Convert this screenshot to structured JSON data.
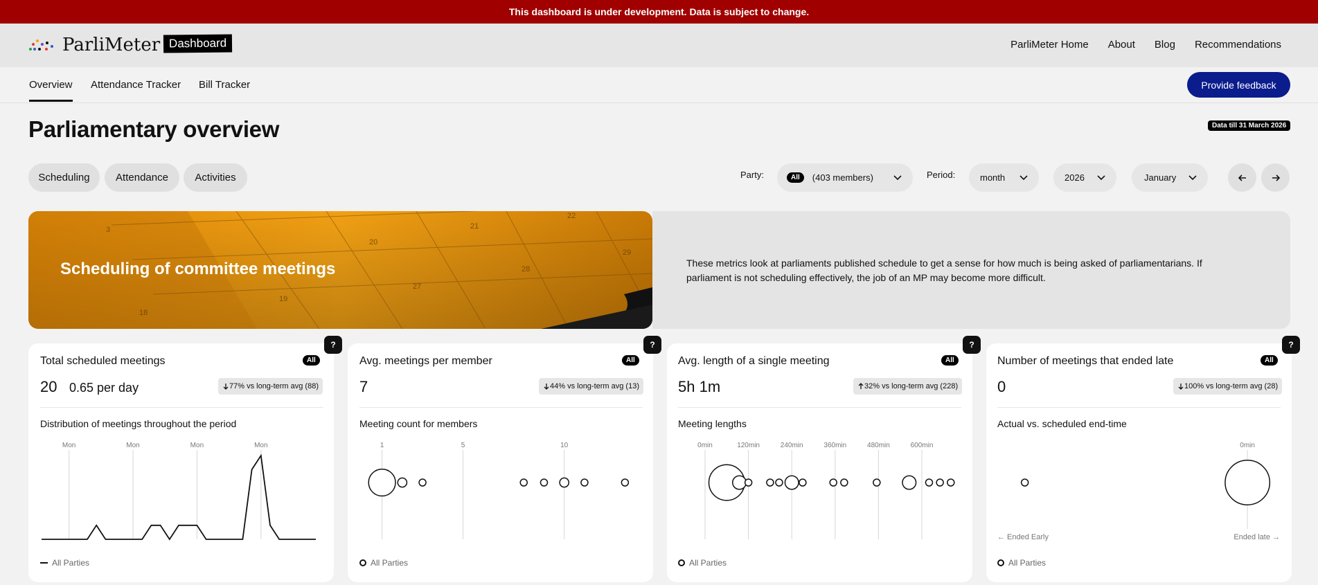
{
  "banner": {
    "text": "This dashboard is under development. Data is subject to change."
  },
  "header": {
    "logo_text": "ParliMeter",
    "badge": "Dashboard",
    "nav": [
      "ParliMeter Home",
      "About",
      "Blog",
      "Recommendations"
    ]
  },
  "subnav": {
    "tabs": [
      "Overview",
      "Attendance Tracker",
      "Bill Tracker"
    ],
    "active": "Overview",
    "feedback": "Provide feedback"
  },
  "page": {
    "title": "Parliamentary overview",
    "data_badge": "Data till 31 March 2026"
  },
  "section_tabs": [
    "Scheduling",
    "Attendance",
    "Activities"
  ],
  "filters": {
    "party_label": "Party:",
    "party_chip": "All",
    "party_value": "(403 members)",
    "period_label": "Period:",
    "period_value": "month",
    "year_value": "2026",
    "month_value": "January"
  },
  "hero": {
    "title": "Scheduling of committee meetings",
    "description": "These metrics look at parliaments published schedule to get a sense for how much is being asked of parliamentarians. If parliament is not scheduling effectively, the job of an MP may become more difficult.",
    "image_numbers": [
      "3",
      "20",
      "21",
      "22",
      "28",
      "29",
      "27",
      "19",
      "18"
    ]
  },
  "cards": [
    {
      "title": "Total scheduled meetings",
      "chip": "All",
      "value": "20",
      "value2": "0.65 per day",
      "compare": "77% vs long-term avg (88)",
      "compare_dir": "down",
      "subtitle": "Distribution of meetings throughout the period",
      "legend": "All Parties"
    },
    {
      "title": "Avg. meetings per member",
      "chip": "All",
      "value": "7",
      "value2": "",
      "compare": "44% vs long-term avg (13)",
      "compare_dir": "down",
      "subtitle": "Meeting count for members",
      "legend": "All Parties"
    },
    {
      "title": "Avg. length of a single meeting",
      "chip": "All",
      "value": "5h 1m",
      "value2": "",
      "compare": "32% vs long-term avg (228)",
      "compare_dir": "up",
      "subtitle": "Meeting lengths",
      "legend": "All Parties"
    },
    {
      "title": "Number of meetings that ended late",
      "chip": "All",
      "value": "0",
      "value2": "",
      "compare": "100% vs long-term avg (28)",
      "compare_dir": "down",
      "subtitle": "Actual vs. scheduled end-time",
      "legend": "All Parties"
    }
  ],
  "chart_data": [
    {
      "type": "line",
      "title": "Distribution of meetings throughout the period",
      "tick_labels": [
        "Mon",
        "Mon",
        "Mon",
        "Mon"
      ],
      "x": [
        1,
        2,
        3,
        4,
        5,
        6,
        7,
        8,
        9,
        10,
        11,
        12,
        13,
        14,
        15,
        16,
        17,
        18,
        19,
        20,
        21,
        22,
        23,
        24,
        25,
        26,
        27,
        28,
        29,
        30,
        31
      ],
      "series": [
        {
          "name": "All Parties",
          "values": [
            0,
            0,
            0,
            0,
            0,
            0,
            1,
            0,
            0,
            0,
            0,
            0,
            1,
            1,
            0,
            1,
            1,
            1,
            0,
            0,
            0,
            0,
            0,
            5,
            6,
            1,
            0,
            0,
            0,
            0,
            0
          ]
        }
      ],
      "ylim": [
        0,
        6
      ]
    },
    {
      "type": "scatter",
      "title": "Meeting count for members",
      "tick_labels": [
        "1",
        "5",
        "10"
      ],
      "x_ticks": [
        1,
        5,
        10
      ],
      "points": [
        {
          "x": 1,
          "size": 5
        },
        {
          "x": 2,
          "size": 1
        },
        {
          "x": 3,
          "size": 0.5
        },
        {
          "x": 8,
          "size": 0.5
        },
        {
          "x": 9,
          "size": 0.5
        },
        {
          "x": 10,
          "size": 1
        },
        {
          "x": 11,
          "size": 0.5
        },
        {
          "x": 13,
          "size": 0.5
        }
      ],
      "xlim": [
        0.5,
        13.5
      ]
    },
    {
      "type": "scatter",
      "title": "Meeting lengths",
      "tick_labels": [
        "0min",
        "120min",
        "240min",
        "360min",
        "480min",
        "600min"
      ],
      "x_ticks": [
        0,
        120,
        240,
        360,
        480,
        600
      ],
      "points": [
        {
          "x": 60,
          "size": 7
        },
        {
          "x": 95,
          "size": 2
        },
        {
          "x": 120,
          "size": 0.5
        },
        {
          "x": 180,
          "size": 0.5
        },
        {
          "x": 205,
          "size": 0.5
        },
        {
          "x": 240,
          "size": 2
        },
        {
          "x": 270,
          "size": 0.5
        },
        {
          "x": 355,
          "size": 0.5
        },
        {
          "x": 385,
          "size": 0.5
        },
        {
          "x": 475,
          "size": 0.5
        },
        {
          "x": 565,
          "size": 2
        },
        {
          "x": 620,
          "size": 0.5
        },
        {
          "x": 650,
          "size": 0.5
        },
        {
          "x": 680,
          "size": 0.5
        }
      ],
      "xlim": [
        0,
        690
      ]
    },
    {
      "type": "scatter",
      "title": "Actual vs. scheduled end-time",
      "tick_labels": [
        "0min"
      ],
      "x_ticks": [
        0
      ],
      "axis_left_label": "← Ended Early",
      "axis_right_label": "Ended late →",
      "points": [
        {
          "x": -525,
          "size": 0.5
        },
        {
          "x": 0,
          "size": 9
        }
      ],
      "xlim": [
        -580,
        70
      ]
    }
  ],
  "colors": {
    "banner": "#a00000",
    "primary_button": "#0b1c8c",
    "hero": "#e8900a"
  }
}
